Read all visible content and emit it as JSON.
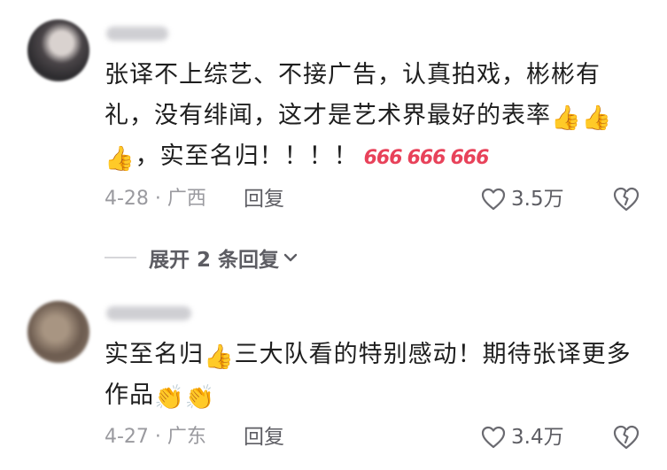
{
  "comments": [
    {
      "text_part1": "张译不上综艺、不接广告，认真拍戏，彬彬有礼，没有绯闻，这才是艺术界最好的表率",
      "text_part2": "，实至名归！！！！",
      "emoji_thumbs": "👍",
      "emoji_666": "666",
      "date_location": "4-28 · 广西",
      "reply_label": "回复",
      "likes": "3.5万"
    },
    {
      "text_part1": "实至名归",
      "text_part2": "三大队看的特别感动！期待张译更多作品",
      "emoji_thumbs": "👍",
      "emoji_clap": "👏",
      "date_location": "4-27 · 广东",
      "reply_label": "回复",
      "likes": "3.4万"
    }
  ],
  "expand_replies": "展开 2 条回复",
  "icons": {
    "heart": "heart-outline-icon",
    "dislike": "broken-heart-icon",
    "chevron": "chevron-down-icon"
  },
  "colors": {
    "text": "#1e1e1e",
    "meta": "#9a9a9f",
    "action": "#5d5d63",
    "accent_666": "#e8425a"
  }
}
